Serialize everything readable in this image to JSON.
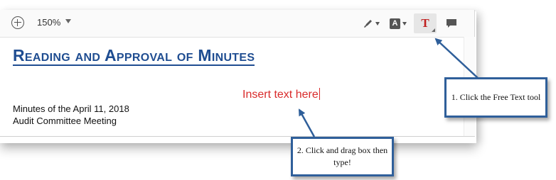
{
  "toolbar": {
    "zoom_in_icon": "plus-circle-icon",
    "zoom_level": "150%",
    "tools": [
      {
        "name": "highlight-pen-icon"
      },
      {
        "name": "text-style-icon",
        "glyph": "A"
      },
      {
        "name": "free-text-icon",
        "glyph": "T",
        "active": true
      },
      {
        "name": "comment-icon"
      }
    ]
  },
  "document": {
    "title": "Reading and Approval of Minutes",
    "line1": "Minutes of the April 11, 2018",
    "line2": "Audit Committee Meeting",
    "inserted_text": "Insert text here"
  },
  "callouts": {
    "step1": "1. Click the Free Text tool",
    "step2": "2. Click and drag box then type!"
  },
  "colors": {
    "title": "#1f4d91",
    "insert_text": "#d92b2b",
    "callout_border": "#2f5f9a"
  }
}
